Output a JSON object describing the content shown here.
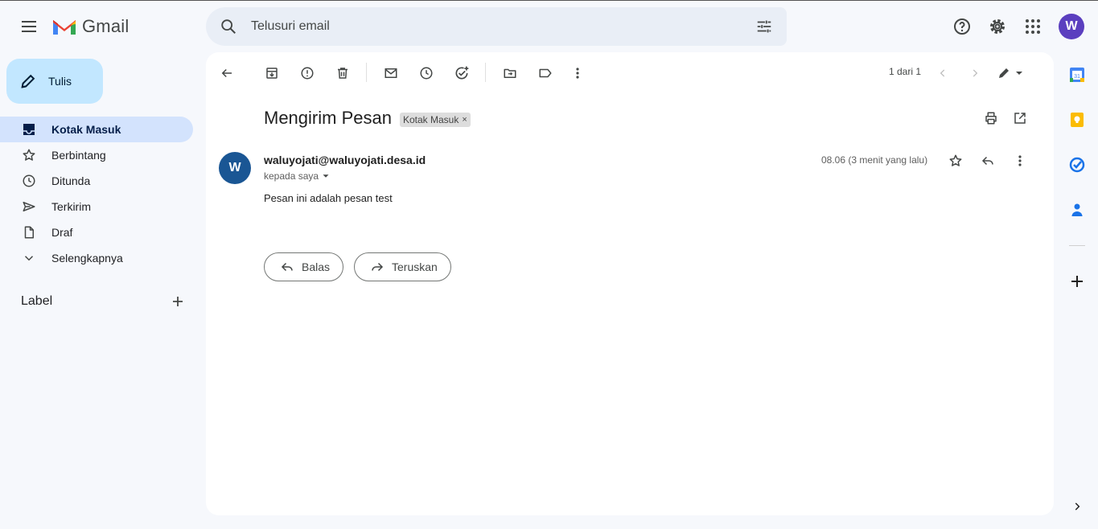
{
  "app": {
    "name": "Gmail",
    "avatar_letter": "W",
    "accent": "#5b3fbf"
  },
  "search": {
    "placeholder": "Telusuri email"
  },
  "compose": {
    "label": "Tulis"
  },
  "sidebar": {
    "items": [
      {
        "label": "Kotak Masuk",
        "icon": "inbox-icon",
        "active": true
      },
      {
        "label": "Berbintang",
        "icon": "star-icon",
        "active": false
      },
      {
        "label": "Ditunda",
        "icon": "clock-icon",
        "active": false
      },
      {
        "label": "Terkirim",
        "icon": "send-icon",
        "active": false
      },
      {
        "label": "Draf",
        "icon": "draft-icon",
        "active": false
      },
      {
        "label": "Selengkapnya",
        "icon": "chevron-down-icon",
        "active": false
      }
    ],
    "labels_title": "Label"
  },
  "toolbar": {
    "pager": "1 dari 1"
  },
  "email": {
    "subject": "Mengirim Pesan",
    "chip": "Kotak Masuk",
    "chip_close": "×",
    "sender_initial": "W",
    "sender": "waluyojati@waluyojati.desa.id",
    "recipient": "kepada saya",
    "time": "08.06 (3 menit yang lalu)",
    "body": "Pesan ini adalah pesan test"
  },
  "actions": {
    "reply": "Balas",
    "forward": "Teruskan"
  }
}
